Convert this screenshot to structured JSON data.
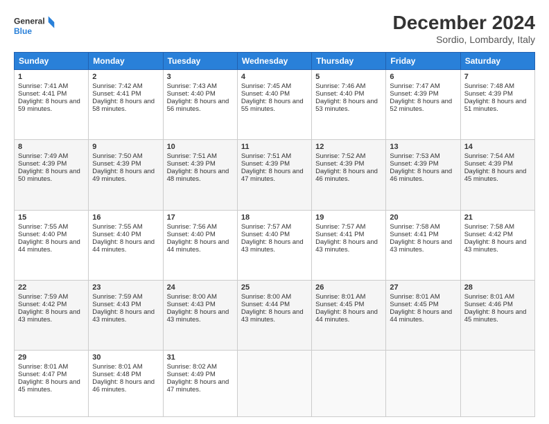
{
  "header": {
    "logo_line1": "General",
    "logo_line2": "Blue",
    "month": "December 2024",
    "location": "Sordio, Lombardy, Italy"
  },
  "days": [
    "Sunday",
    "Monday",
    "Tuesday",
    "Wednesday",
    "Thursday",
    "Friday",
    "Saturday"
  ],
  "weeks": [
    [
      {
        "day": "1",
        "rise": "7:41 AM",
        "set": "4:41 PM",
        "daylight": "8 hours and 59 minutes."
      },
      {
        "day": "2",
        "rise": "7:42 AM",
        "set": "4:41 PM",
        "daylight": "8 hours and 58 minutes."
      },
      {
        "day": "3",
        "rise": "7:43 AM",
        "set": "4:40 PM",
        "daylight": "8 hours and 56 minutes."
      },
      {
        "day": "4",
        "rise": "7:45 AM",
        "set": "4:40 PM",
        "daylight": "8 hours and 55 minutes."
      },
      {
        "day": "5",
        "rise": "7:46 AM",
        "set": "4:40 PM",
        "daylight": "8 hours and 53 minutes."
      },
      {
        "day": "6",
        "rise": "7:47 AM",
        "set": "4:39 PM",
        "daylight": "8 hours and 52 minutes."
      },
      {
        "day": "7",
        "rise": "7:48 AM",
        "set": "4:39 PM",
        "daylight": "8 hours and 51 minutes."
      }
    ],
    [
      {
        "day": "8",
        "rise": "7:49 AM",
        "set": "4:39 PM",
        "daylight": "8 hours and 50 minutes."
      },
      {
        "day": "9",
        "rise": "7:50 AM",
        "set": "4:39 PM",
        "daylight": "8 hours and 49 minutes."
      },
      {
        "day": "10",
        "rise": "7:51 AM",
        "set": "4:39 PM",
        "daylight": "8 hours and 48 minutes."
      },
      {
        "day": "11",
        "rise": "7:51 AM",
        "set": "4:39 PM",
        "daylight": "8 hours and 47 minutes."
      },
      {
        "day": "12",
        "rise": "7:52 AM",
        "set": "4:39 PM",
        "daylight": "8 hours and 46 minutes."
      },
      {
        "day": "13",
        "rise": "7:53 AM",
        "set": "4:39 PM",
        "daylight": "8 hours and 46 minutes."
      },
      {
        "day": "14",
        "rise": "7:54 AM",
        "set": "4:39 PM",
        "daylight": "8 hours and 45 minutes."
      }
    ],
    [
      {
        "day": "15",
        "rise": "7:55 AM",
        "set": "4:40 PM",
        "daylight": "8 hours and 44 minutes."
      },
      {
        "day": "16",
        "rise": "7:55 AM",
        "set": "4:40 PM",
        "daylight": "8 hours and 44 minutes."
      },
      {
        "day": "17",
        "rise": "7:56 AM",
        "set": "4:40 PM",
        "daylight": "8 hours and 44 minutes."
      },
      {
        "day": "18",
        "rise": "7:57 AM",
        "set": "4:40 PM",
        "daylight": "8 hours and 43 minutes."
      },
      {
        "day": "19",
        "rise": "7:57 AM",
        "set": "4:41 PM",
        "daylight": "8 hours and 43 minutes."
      },
      {
        "day": "20",
        "rise": "7:58 AM",
        "set": "4:41 PM",
        "daylight": "8 hours and 43 minutes."
      },
      {
        "day": "21",
        "rise": "7:58 AM",
        "set": "4:42 PM",
        "daylight": "8 hours and 43 minutes."
      }
    ],
    [
      {
        "day": "22",
        "rise": "7:59 AM",
        "set": "4:42 PM",
        "daylight": "8 hours and 43 minutes."
      },
      {
        "day": "23",
        "rise": "7:59 AM",
        "set": "4:43 PM",
        "daylight": "8 hours and 43 minutes."
      },
      {
        "day": "24",
        "rise": "8:00 AM",
        "set": "4:43 PM",
        "daylight": "8 hours and 43 minutes."
      },
      {
        "day": "25",
        "rise": "8:00 AM",
        "set": "4:44 PM",
        "daylight": "8 hours and 43 minutes."
      },
      {
        "day": "26",
        "rise": "8:01 AM",
        "set": "4:45 PM",
        "daylight": "8 hours and 44 minutes."
      },
      {
        "day": "27",
        "rise": "8:01 AM",
        "set": "4:45 PM",
        "daylight": "8 hours and 44 minutes."
      },
      {
        "day": "28",
        "rise": "8:01 AM",
        "set": "4:46 PM",
        "daylight": "8 hours and 45 minutes."
      }
    ],
    [
      {
        "day": "29",
        "rise": "8:01 AM",
        "set": "4:47 PM",
        "daylight": "8 hours and 45 minutes."
      },
      {
        "day": "30",
        "rise": "8:01 AM",
        "set": "4:48 PM",
        "daylight": "8 hours and 46 minutes."
      },
      {
        "day": "31",
        "rise": "8:02 AM",
        "set": "4:49 PM",
        "daylight": "8 hours and 47 minutes."
      },
      null,
      null,
      null,
      null
    ]
  ],
  "labels": {
    "sunrise": "Sunrise:",
    "sunset": "Sunset:",
    "daylight": "Daylight:"
  }
}
